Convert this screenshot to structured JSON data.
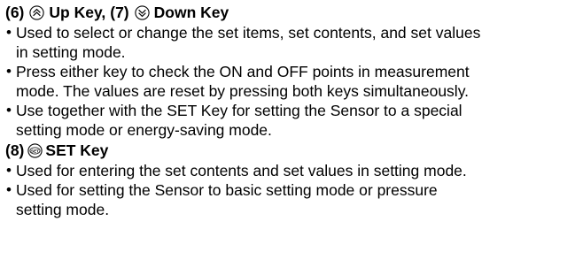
{
  "section1": {
    "num_up": "(6)",
    "up_label": "Up Key,",
    "num_down": "(7)",
    "down_label": "Down Key",
    "icons": {
      "up": "double-chevron-up-icon",
      "down": "double-chevron-down-icon"
    },
    "bullets": [
      {
        "line1": "Used to select or change the set items, set contents, and set values",
        "line2": "in setting mode."
      },
      {
        "line1": "Press either key to check the ON and OFF points in measurement",
        "line2": "mode. The values are reset by pressing both keys simultaneously."
      },
      {
        "line1": "Use together with the SET Key for setting the Sensor to a special",
        "line2": "setting mode or energy-saving mode."
      }
    ]
  },
  "section2": {
    "num": "(8)",
    "label": "SET Key",
    "icon": "set-key-icon",
    "icon_text": "SET",
    "bullets": [
      {
        "line1": "Used for entering the set contents and set values in setting mode.",
        "line2": ""
      },
      {
        "line1": "Used for setting the Sensor to basic setting mode or pressure",
        "line2": "setting mode."
      }
    ]
  },
  "bullet_char": "•"
}
